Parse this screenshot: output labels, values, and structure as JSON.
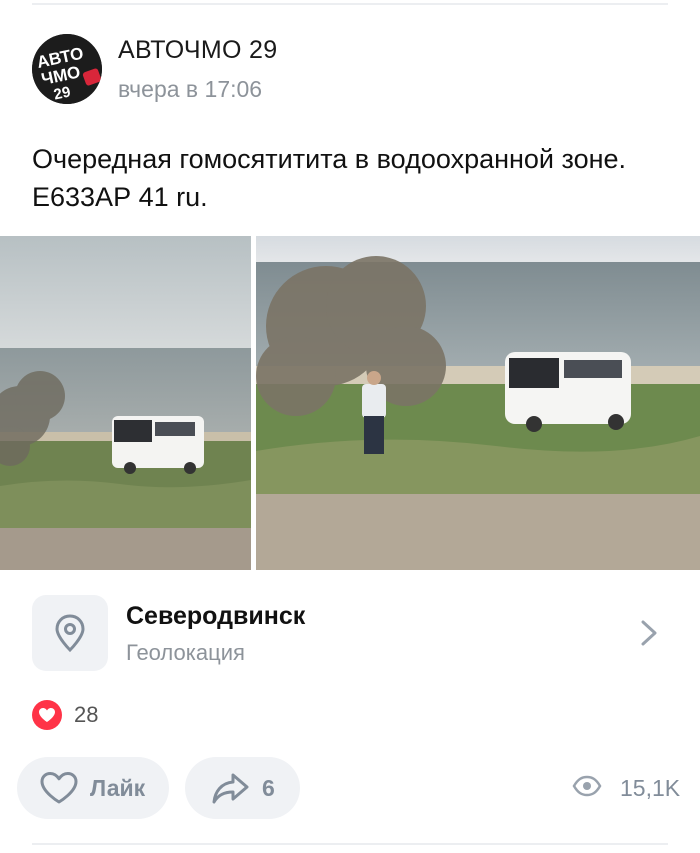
{
  "post": {
    "author": "АВТОЧМО 29",
    "time": "вчера в 17:06",
    "avatar_text": [
      "АВТО",
      "ЧМО",
      "29"
    ],
    "text_lines": [
      "Очередная гомосятитита в водоохранной зоне.",
      "Е633АР 41 ru."
    ]
  },
  "photos": [
    {
      "name": "photo-1",
      "description_icon": "photo"
    },
    {
      "name": "photo-2",
      "description_icon": "photo"
    }
  ],
  "location": {
    "title": "Северодвинск",
    "subtitle": "Геолокация",
    "icon": "location-pin-icon"
  },
  "reactions": {
    "icon": "heart-icon",
    "count": "28"
  },
  "actions": {
    "like_label": "Лайк",
    "share_count": "6",
    "views": "15,1K"
  },
  "colors": {
    "accent_heart": "#ff3347",
    "secondary_text": "#8d939a",
    "button_bg": "#f0f2f5",
    "icon_gray": "#818c99"
  }
}
